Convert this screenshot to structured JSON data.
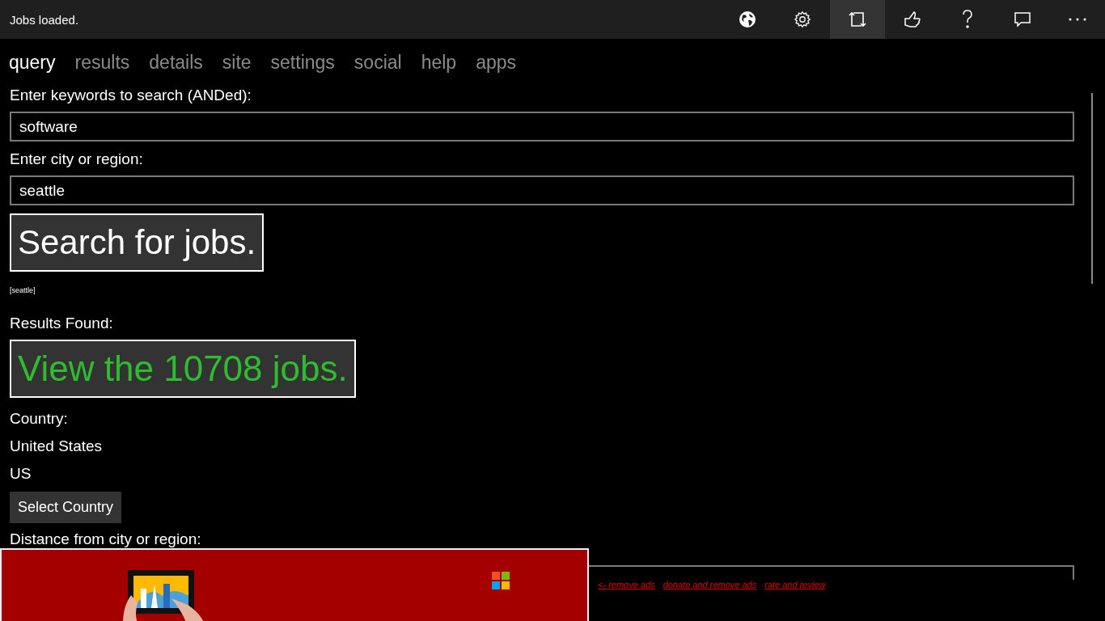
{
  "status_bar": {
    "text": "Jobs loaded."
  },
  "toolbar": [
    {
      "kind": "globe",
      "selected": false
    },
    {
      "kind": "settings",
      "selected": false
    },
    {
      "kind": "repeat",
      "selected": true
    },
    {
      "kind": "like",
      "selected": false
    },
    {
      "kind": "help",
      "selected": false
    },
    {
      "kind": "comment",
      "selected": false
    },
    {
      "kind": "more",
      "selected": false
    }
  ],
  "tabs": [
    {
      "label": "query",
      "selected": true
    },
    {
      "label": "results",
      "selected": false
    },
    {
      "label": "details",
      "selected": false
    },
    {
      "label": "site",
      "selected": false
    },
    {
      "label": "settings",
      "selected": false
    },
    {
      "label": "social",
      "selected": false
    },
    {
      "label": "help",
      "selected": false
    },
    {
      "label": "apps",
      "selected": false
    }
  ],
  "keywords": {
    "label": "Enter keywords to search (ANDed):",
    "value": "software"
  },
  "location": {
    "label": "Enter city or region:",
    "value": "seattle"
  },
  "search_button": "Search for jobs.",
  "query_echo": "[seattle]",
  "results": {
    "label": "Results Found:",
    "button": "View the 10708 jobs."
  },
  "country": {
    "label": "Country:",
    "name": "United States",
    "code": "US",
    "button": "Select Country"
  },
  "distance": {
    "label": "Distance from city or region:"
  },
  "ad_links": [
    "<- remove ads",
    "donate and remove ads",
    "rate and review"
  ]
}
